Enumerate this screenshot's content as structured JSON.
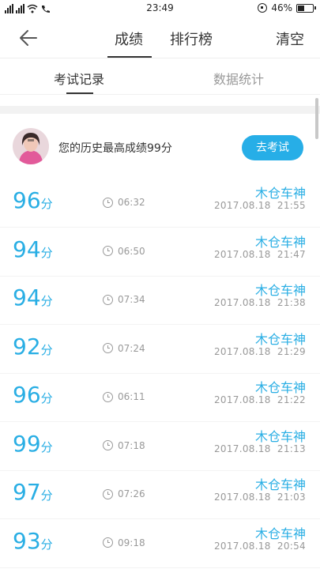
{
  "status_bar": {
    "time": "23:49",
    "battery": "46%",
    "battery_level": 0.46
  },
  "header": {
    "tab_scores": "成绩",
    "tab_ranking": "排行榜",
    "clear": "清空"
  },
  "subtabs": {
    "records": "考试记录",
    "stats": "数据统计"
  },
  "profile": {
    "best_text": "您的历史最高成绩99分",
    "exam_button": "去考试"
  },
  "records": [
    {
      "score": "96",
      "unit": "分",
      "duration": "06:32",
      "name": "木仓车神",
      "date": "2017.08.18  21:55"
    },
    {
      "score": "94",
      "unit": "分",
      "duration": "06:50",
      "name": "木仓车神",
      "date": "2017.08.18  21:47"
    },
    {
      "score": "94",
      "unit": "分",
      "duration": "07:34",
      "name": "木仓车神",
      "date": "2017.08.18  21:38"
    },
    {
      "score": "92",
      "unit": "分",
      "duration": "07:24",
      "name": "木仓车神",
      "date": "2017.08.18  21:29"
    },
    {
      "score": "96",
      "unit": "分",
      "duration": "06:11",
      "name": "木仓车神",
      "date": "2017.08.18  21:22"
    },
    {
      "score": "99",
      "unit": "分",
      "duration": "07:18",
      "name": "木仓车神",
      "date": "2017.08.18  21:13"
    },
    {
      "score": "97",
      "unit": "分",
      "duration": "07:26",
      "name": "木仓车神",
      "date": "2017.08.18  21:03"
    },
    {
      "score": "93",
      "unit": "分",
      "duration": "09:18",
      "name": "木仓车神",
      "date": "2017.08.18  20:54"
    }
  ]
}
